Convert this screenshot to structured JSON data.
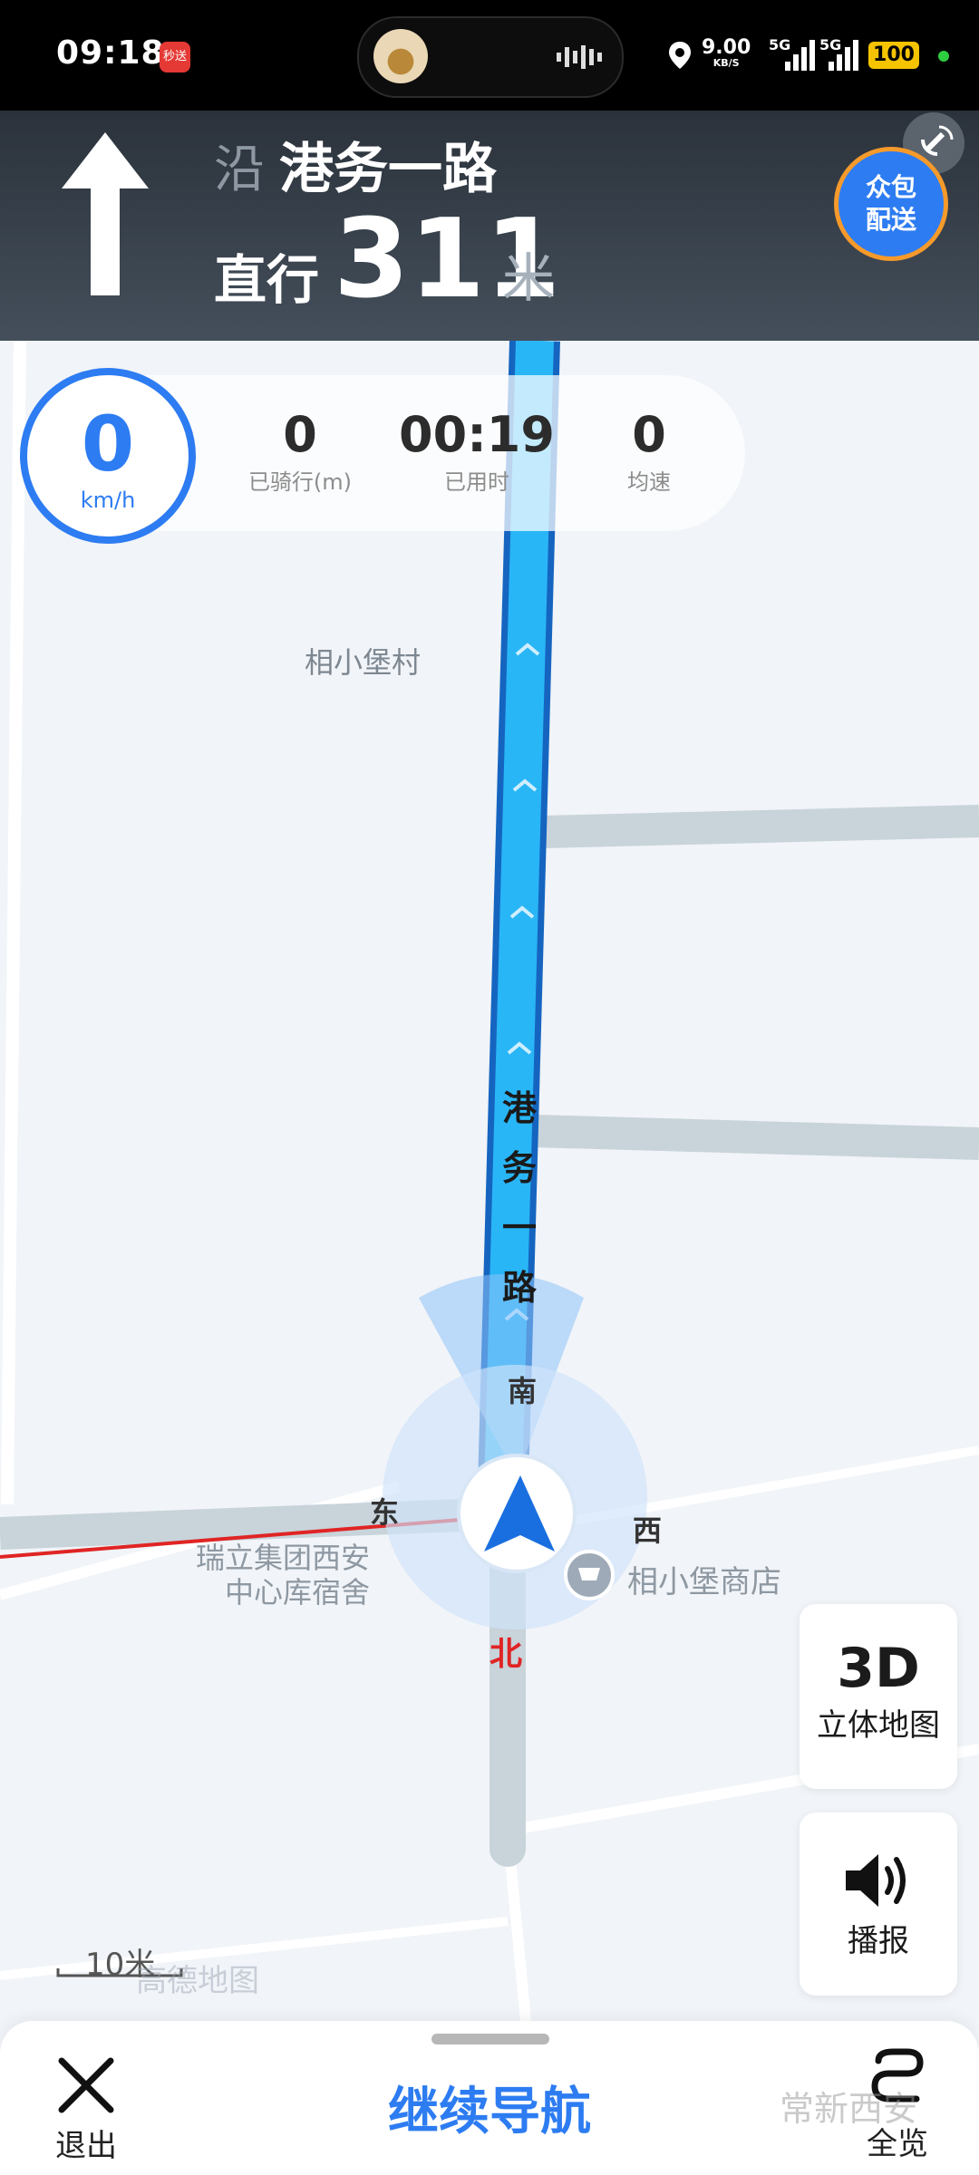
{
  "status_bar": {
    "time": "09:18",
    "app_badge": "秒送",
    "net_speed_value": "9.00",
    "net_speed_unit": "KB/S",
    "signal_1": "5G",
    "signal_2": "5G",
    "battery": "100"
  },
  "nav_header": {
    "along_prefix": "沿",
    "road_name": "港务一路",
    "action": "直行",
    "distance": "311",
    "distance_unit": "米",
    "crowd_button_line1": "众包",
    "crowd_button_line2": "配送"
  },
  "trip_stats": {
    "speed": "0",
    "speed_unit": "km/h",
    "ridden_value": "0",
    "ridden_label": "已骑行(m)",
    "time_value": "00:19",
    "time_label": "已用时",
    "avg_value": "0",
    "avg_label": "均速"
  },
  "map": {
    "village_label": "相小堡村",
    "road_label_chars": [
      "港",
      "务",
      "一",
      "路"
    ],
    "compass_south": "南",
    "compass_east": "东",
    "compass_west": "西",
    "compass_north": "北",
    "poi_dorm_line1": "瑞立集团西安",
    "poi_dorm_line2": "中心库宿舍",
    "poi_shop": "相小堡商店",
    "scale_label": "10米",
    "brand_label": "高德地图",
    "route_color": "#2196f3",
    "red_line_color": "#e02424"
  },
  "map_buttons": {
    "three_d_big": "3D",
    "three_d_label": "立体地图",
    "voice_label": "播报",
    "voice_icon": "speaker-icon"
  },
  "bottom_bar": {
    "exit_label": "退出",
    "continue_label": "继续导航",
    "overview_label": "全览",
    "watermark": "常新西安"
  }
}
